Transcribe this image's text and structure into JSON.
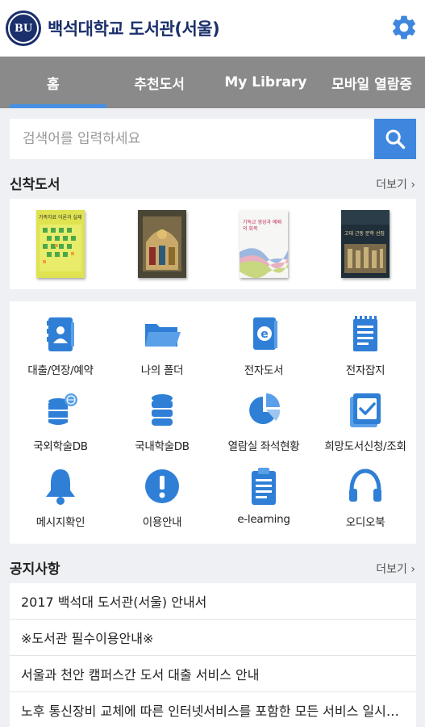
{
  "header": {
    "logo_text": "BU",
    "title": "백석대학교 도서관(서울)"
  },
  "tabs": [
    {
      "label": "홈",
      "active": true
    },
    {
      "label": "추천도서",
      "active": false
    },
    {
      "label": "My Library",
      "active": false
    },
    {
      "label": "모바일 열람증",
      "active": false
    }
  ],
  "search": {
    "placeholder": "검색어를 입력하세요",
    "value": ""
  },
  "new_books": {
    "title": "신착도서",
    "more_label": "더보기 ›",
    "book_cover_texts": [
      "가족치료 이론과 실제",
      "",
      "기독교 영성과 예배의 회복",
      "고대 근동 문학 선집"
    ]
  },
  "menu": [
    {
      "label": "대출/연장/예약",
      "icon": "contact-book-icon"
    },
    {
      "label": "나의 폴더",
      "icon": "folder-icon"
    },
    {
      "label": "전자도서",
      "icon": "ebook-icon"
    },
    {
      "label": "전자잡지",
      "icon": "magazine-icon"
    },
    {
      "label": "국외학술DB",
      "icon": "database-global-icon"
    },
    {
      "label": "국내학술DB",
      "icon": "database-icon"
    },
    {
      "label": "열람실 좌석현황",
      "icon": "pie-chart-icon"
    },
    {
      "label": "희망도서신청/조회",
      "icon": "check-document-icon"
    },
    {
      "label": "메시지확인",
      "icon": "bell-icon"
    },
    {
      "label": "이용안내",
      "icon": "exclamation-icon"
    },
    {
      "label": "e-learning",
      "icon": "clipboard-icon"
    },
    {
      "label": "오디오북",
      "icon": "headphones-icon"
    }
  ],
  "notices": {
    "title": "공지사항",
    "more_label": "더보기 ›",
    "items": [
      "2017 백석대 도서관(서울) 안내서",
      "※도서관 필수이용안내※",
      "서울과 천안 캠퍼스간 도서 대출 서비스 안내",
      "노후 통신장비 교체에 따른 인터넷서비스를 포함한 모든 서비스 일시중단 안내"
    ]
  },
  "colors": {
    "brand_navy": "#1a2f6b",
    "accent_blue": "#3f87de",
    "tab_bar_gray": "#8a8a8a",
    "active_tab_indicator": "#4a90e2"
  }
}
